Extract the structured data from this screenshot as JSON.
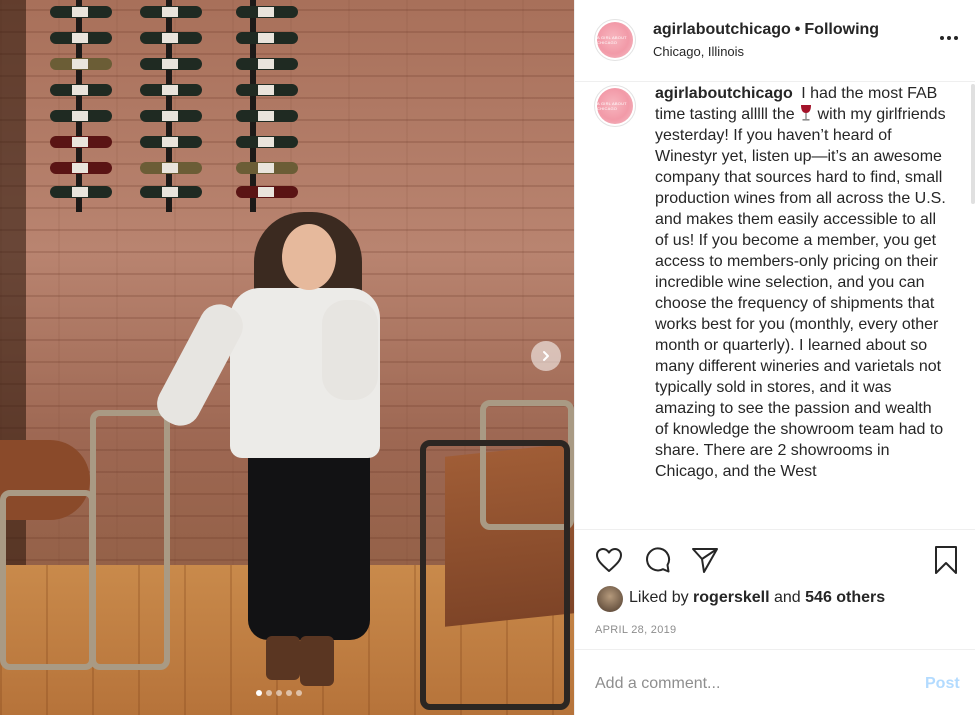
{
  "post": {
    "username": "agirlaboutchicago",
    "separator": "•",
    "follow_status": "Following",
    "location": "Chicago, Illinois",
    "avatar_text": "A GIRL ABOUT CHICAGO",
    "caption_before_emoji": "I had the most FAB time tasting alllll the",
    "caption_emoji": "🍷",
    "caption_after_emoji": "with my girlfriends yesterday! If you haven’t heard of Winestyr yet, listen up—it’s an awesome company that sources hard to find, small production wines from all across the U.S. and makes them easily accessible to all of us! If you become a member, you get access to members-only pricing on their incredible wine selection, and you can choose the frequency of shipments that works best for you (monthly, every other month or quarterly). I learned about so many different wineries and varietals not typically sold in stores, and it was amazing to see the passion and wealth of knowledge the showroom team had to share. There are 2 showrooms in Chicago, and the West",
    "likes": {
      "prefix": "Liked by",
      "first_user": "rogerskell",
      "conjunction": "and",
      "others": "546 others"
    },
    "date": "APRIL 28, 2019"
  },
  "carousel": {
    "slide_count": 5,
    "active_index": 0
  },
  "comment": {
    "placeholder": "Add a comment...",
    "post_label": "Post"
  },
  "icons": {
    "more": "more-options-icon",
    "like": "heart-icon",
    "comment": "comment-bubble-icon",
    "share": "paper-plane-icon",
    "save": "bookmark-icon",
    "next": "chevron-right-icon"
  },
  "colors": {
    "text": "#262626",
    "muted": "#8e8e8e",
    "post_disabled": "#b3dbff",
    "avatar_pink": "#f29aa8"
  }
}
